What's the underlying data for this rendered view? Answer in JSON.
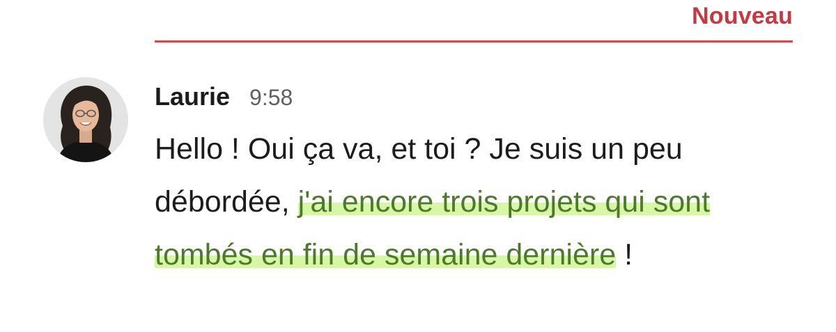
{
  "divider": {
    "label": "Nouveau",
    "color": "#c8383f"
  },
  "message": {
    "author": "Laurie",
    "time": "9:58",
    "text_before": "Hello ! Oui ça va, et toi ? Je suis un peu débordée, ",
    "text_highlighted": "j'ai encore trois projets qui sont tombés en fin de semaine dernière",
    "text_after": " !",
    "highlight_color": "#d8f7a6"
  },
  "avatar": {
    "icon": "user-avatar-photo"
  }
}
